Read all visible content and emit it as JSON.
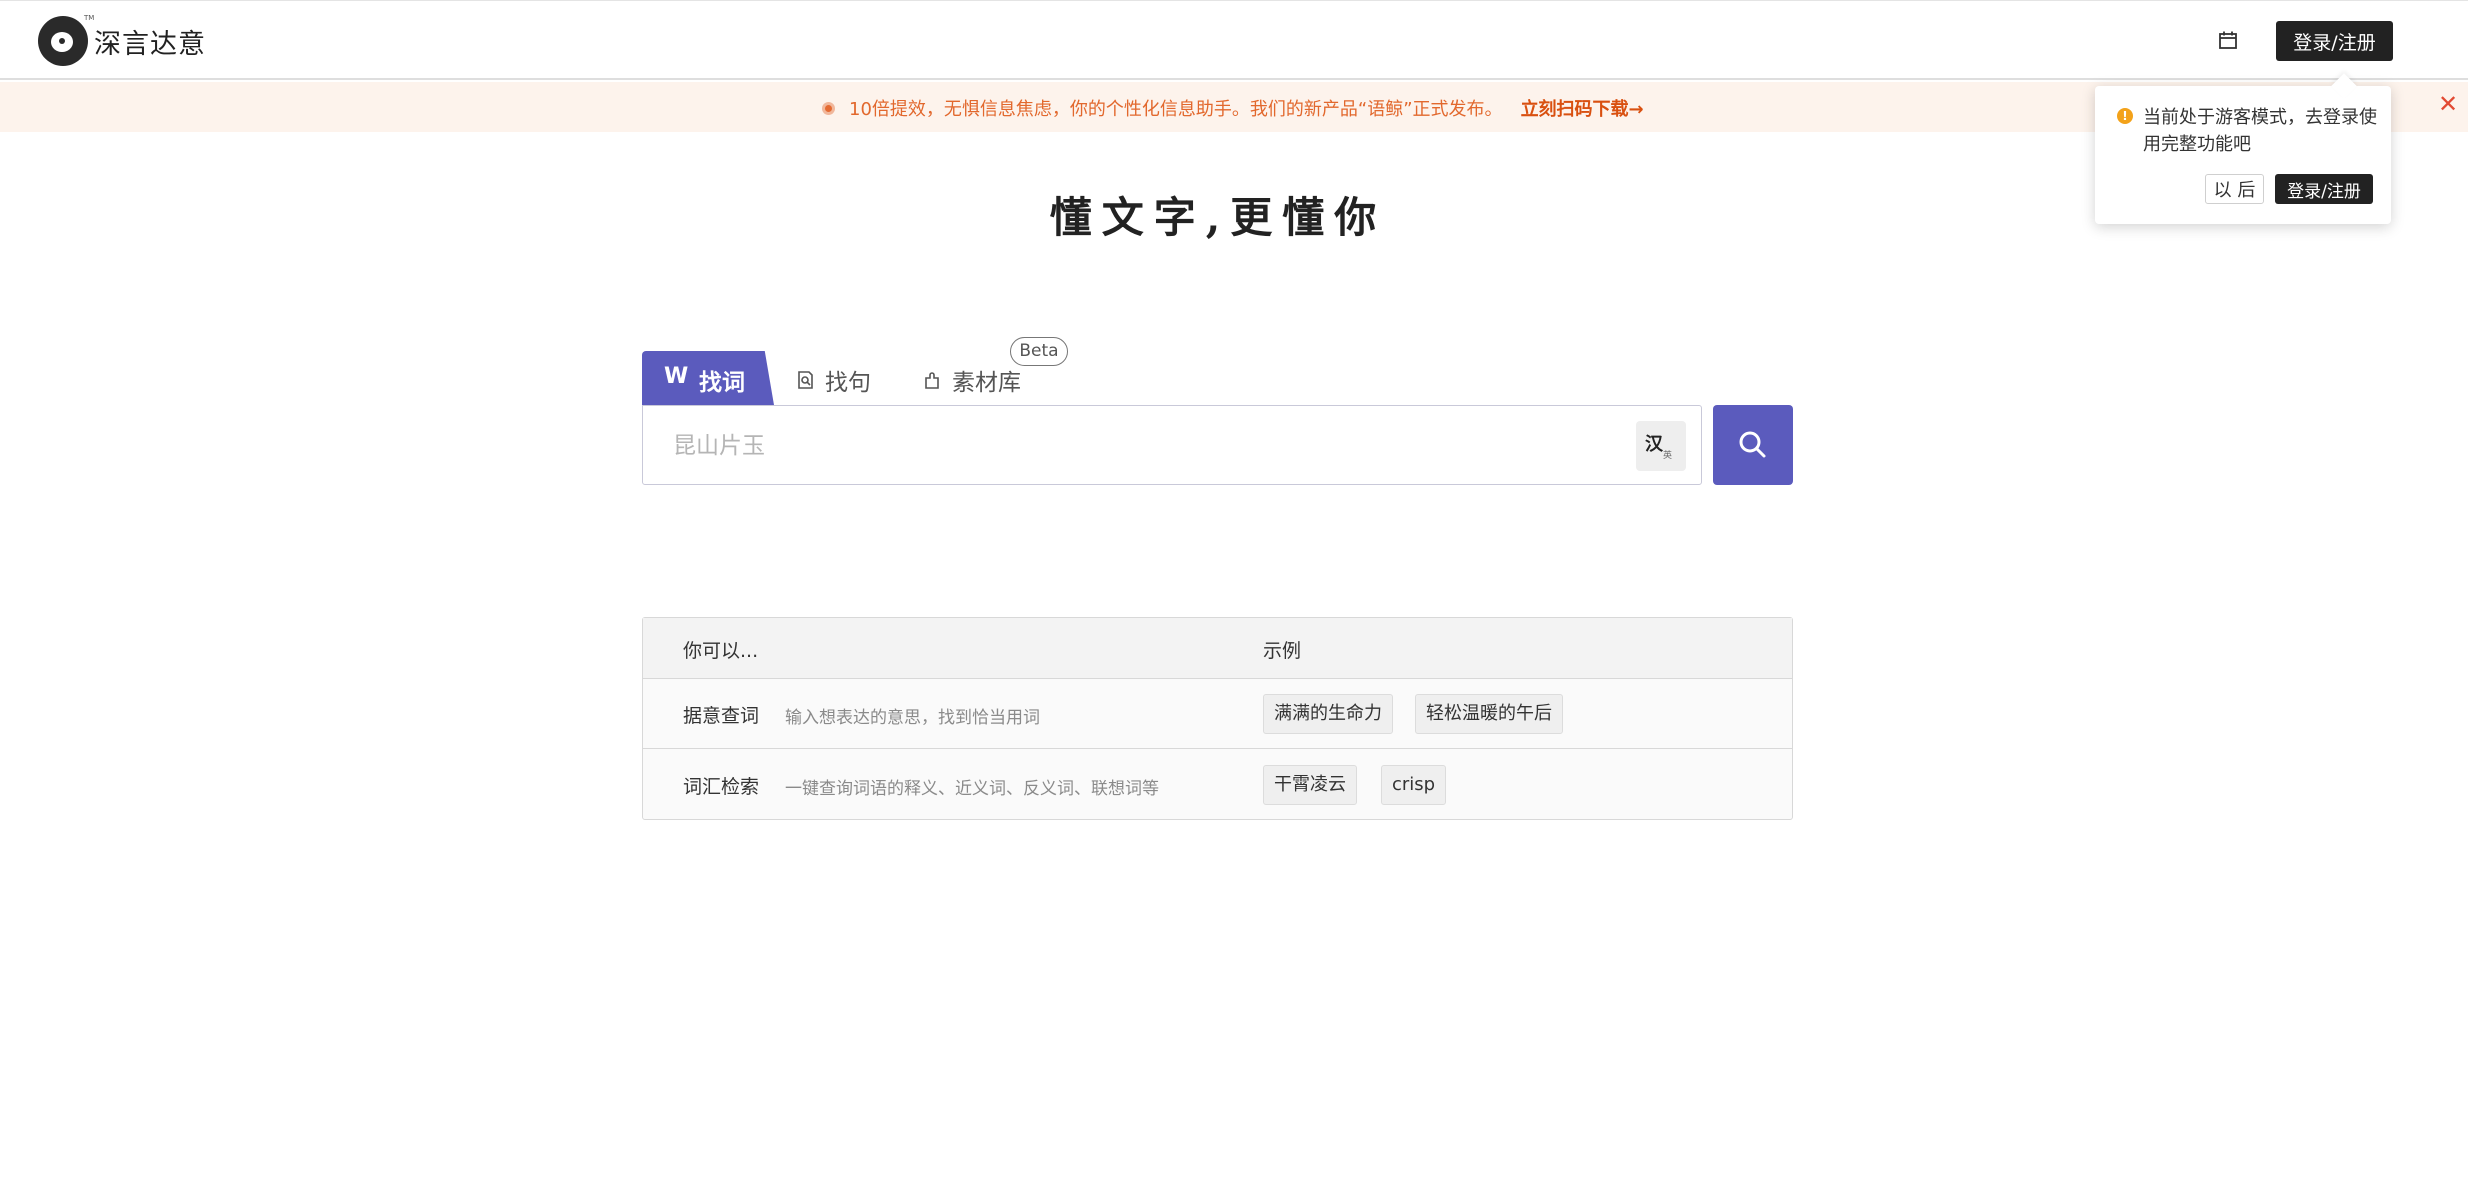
{
  "header": {
    "brand_name": "深言达意",
    "trademark": "TM",
    "login_label": "登录/注册"
  },
  "notice": {
    "text": "10倍提效，无惧信息焦虑，你的个性化信息助手。我们的新产品“语鲸”正式发布。",
    "link": "立刻扫码下载→",
    "close": "✕"
  },
  "popover": {
    "warn_icon": "!",
    "message": "当前处于游客模式，去登录使用完整功能吧",
    "later_label": "以 后",
    "login_label": "登录/注册"
  },
  "slogan": "懂文字,更懂你",
  "tabs": {
    "words": {
      "icon": "W",
      "label": "找词"
    },
    "sentences": {
      "label": "找句"
    },
    "materials": {
      "label": "素材库",
      "badge": "Beta"
    }
  },
  "search": {
    "placeholder": "昆山片玉",
    "ime_label": "汉",
    "ime_sub": "英"
  },
  "table": {
    "headers": [
      "你可以...",
      "示例"
    ],
    "rows": [
      {
        "name": "据意查词",
        "desc": "输入想表达的意思，找到恰当用词",
        "examples": [
          "满满的生命力",
          "轻松温暖的午后"
        ]
      },
      {
        "name": "词汇检索",
        "desc": "一键查询词语的释义、近义词、反义词、联想词等",
        "examples": [
          "干霄凌云",
          "crisp"
        ]
      }
    ]
  },
  "colors": {
    "accent": "#5b5bbd",
    "notice_bg": "#fdf3ec",
    "notice_text": "#e2682d",
    "dark": "#222222"
  }
}
